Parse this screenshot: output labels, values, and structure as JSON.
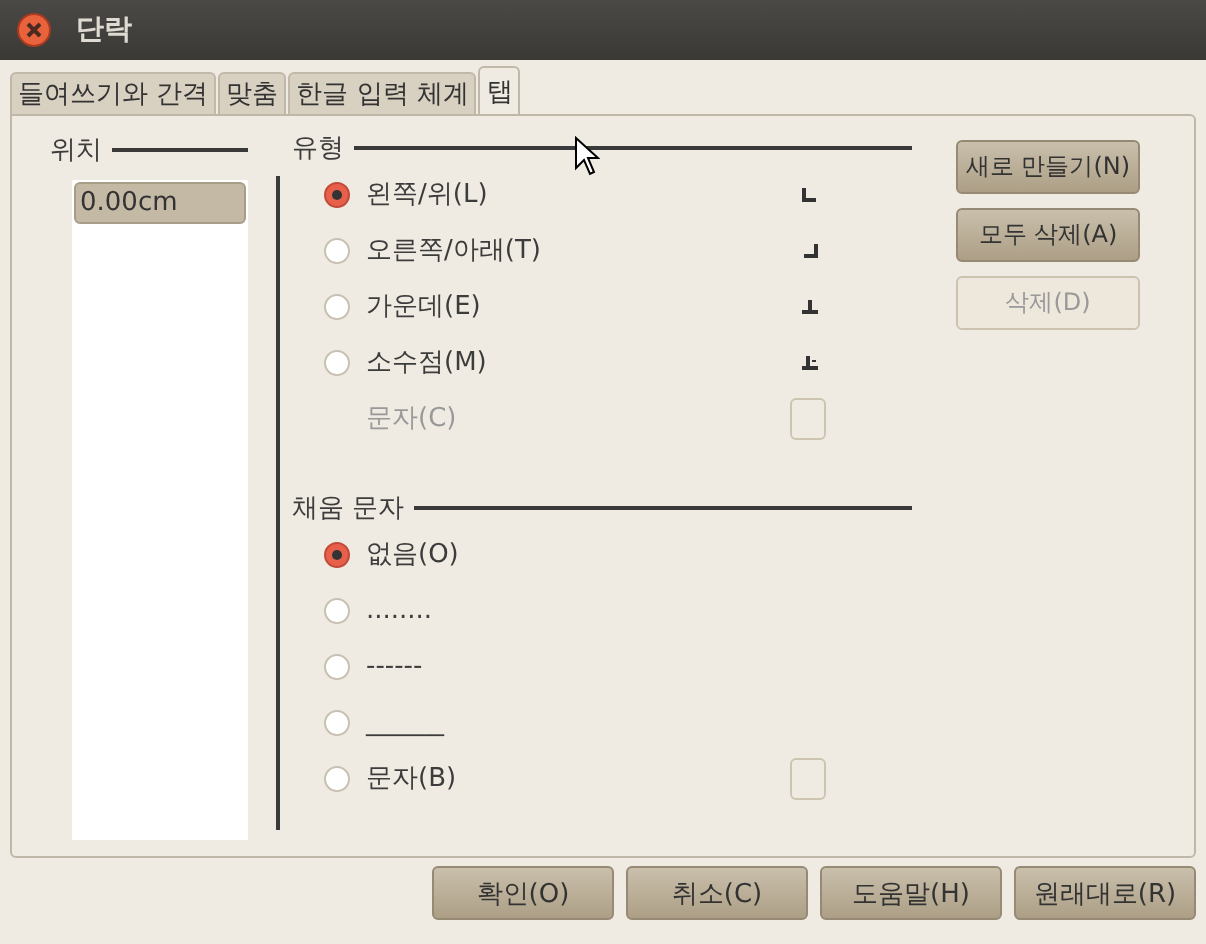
{
  "window": {
    "title": "단락"
  },
  "tabs": [
    {
      "label": "들여쓰기와 간격",
      "selected": false
    },
    {
      "label": "맞춤",
      "selected": false
    },
    {
      "label": "한글 입력 체계",
      "selected": false
    },
    {
      "label": "탭",
      "selected": true
    }
  ],
  "position": {
    "heading": "위치",
    "value": "0.00cm"
  },
  "type": {
    "heading": "유형",
    "options": [
      {
        "label": "왼쪽/위(L)",
        "selected": true,
        "kind": "left"
      },
      {
        "label": "오른쪽/아래(T)",
        "selected": false,
        "kind": "right"
      },
      {
        "label": "가운데(E)",
        "selected": false,
        "kind": "center"
      },
      {
        "label": "소수점(M)",
        "selected": false,
        "kind": "decimal"
      }
    ],
    "character": {
      "label": "문자(C)",
      "disabled": true
    }
  },
  "fill": {
    "heading": "채움 문자",
    "options": [
      {
        "label": "없음(O)",
        "selected": true,
        "kind": "preset"
      },
      {
        "label": "........",
        "selected": false,
        "kind": "preset"
      },
      {
        "label": "------",
        "selected": false,
        "kind": "preset"
      },
      {
        "label": "______",
        "selected": false,
        "kind": "preset"
      },
      {
        "label": "문자(B)",
        "selected": false,
        "kind": "character"
      }
    ]
  },
  "side_buttons": [
    {
      "label": "새로 만들기(N)",
      "disabled": false
    },
    {
      "label": "모두 삭제(A)",
      "disabled": false
    },
    {
      "label": "삭제(D)",
      "disabled": true
    }
  ],
  "buttons": [
    "확인(O)",
    "취소(C)",
    "도움말(H)",
    "원래대로(R)"
  ]
}
